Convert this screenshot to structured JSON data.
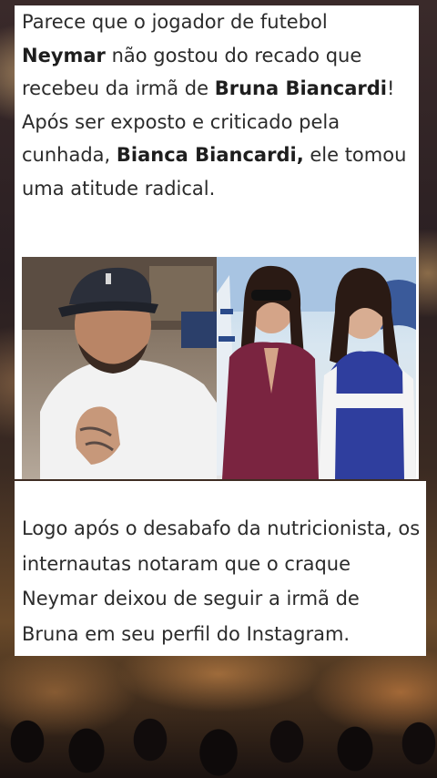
{
  "top_text": {
    "p1": "Parece que o jogador de futebol ",
    "b1": "Neymar",
    "p2": " não gostou do recado que recebeu da irmã de ",
    "b2": "Bruna Biancardi",
    "p3": "! Após ser exposto e criticado pela cunhada, ",
    "b3": "Bianca Biancardi,",
    "p4": " ele tomou uma atitude radical."
  },
  "bottom_text": "Logo após o desabafo da nutricionista, os internautas notaram que o craque Neymar deixou de seguir a irmã de Bruna em seu perfil do Instagram.",
  "colors": {
    "panel": "#ffffff",
    "text": "#2b2b2b"
  }
}
